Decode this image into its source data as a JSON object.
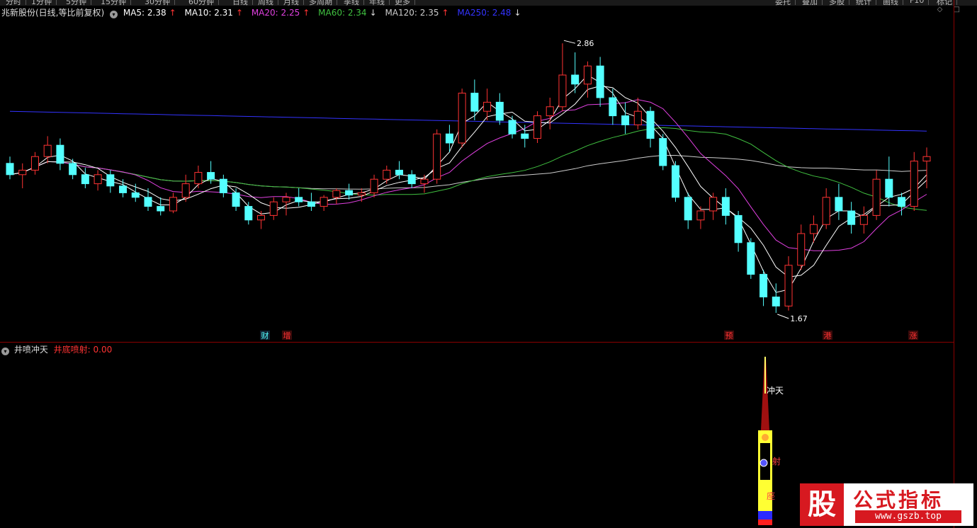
{
  "app": {
    "top_tabs": [
      "分时",
      "1分钟",
      "5分钟",
      "15分钟",
      "30分钟",
      "60分钟",
      "日线",
      "周线",
      "月线",
      "多周期",
      "季线",
      "年线",
      "更多"
    ],
    "right_tabs": [
      "委托",
      "叠加",
      "多股",
      "统计",
      "画线",
      "F10",
      "标记"
    ]
  },
  "main_legend": {
    "stock_title": "兆新股份(日线,等比前复权)",
    "ma5": "MA5: 2.38",
    "ma5_arrow": "↑",
    "ma10": "MA10: 2.31",
    "ma10_arrow": "↑",
    "ma20": "MA20: 2.25",
    "ma20_arrow": "↑",
    "ma60": "MA60: 2.34",
    "ma60_arrow": "↓",
    "ma120": "MA120: 2.35",
    "ma120_arrow": "↑",
    "ma250": "MA250: 2.48",
    "ma250_arrow": "↓"
  },
  "colors": {
    "up": "#ff3333",
    "down": "#54ffff",
    "ma5": "#ffffff",
    "ma10": "#ffffff",
    "ma20": "#e040e0",
    "ma60": "#40c040",
    "ma120": "#cccccc",
    "ma250": "#3333ff"
  },
  "annotations": {
    "high_label": "2.86",
    "low_label": "1.67",
    "event_markers": [
      "财",
      "增",
      "预",
      "港",
      "涨"
    ]
  },
  "sub_legend": {
    "indicator_name": "井喷冲天",
    "indicator_value": "井底喷射: 0.00"
  },
  "sub_annotations": {
    "label_top": "冲天",
    "label_mid": "射",
    "label_bottom": "座"
  },
  "watermark": {
    "logo_char": "股",
    "title": "公式指标",
    "url": "www.gszb.top"
  },
  "chart_data": {
    "type": "candlestick",
    "price_extremes": {
      "high": 2.86,
      "low": 1.67
    },
    "ohlc": [
      [
        2.33,
        2.36,
        2.26,
        2.28
      ],
      [
        2.28,
        2.33,
        2.22,
        2.3
      ],
      [
        2.3,
        2.38,
        2.28,
        2.36
      ],
      [
        2.36,
        2.45,
        2.33,
        2.41
      ],
      [
        2.41,
        2.44,
        2.3,
        2.33
      ],
      [
        2.33,
        2.35,
        2.26,
        2.28
      ],
      [
        2.28,
        2.31,
        2.22,
        2.24
      ],
      [
        2.24,
        2.3,
        2.21,
        2.28
      ],
      [
        2.28,
        2.3,
        2.2,
        2.23
      ],
      [
        2.23,
        2.26,
        2.18,
        2.2
      ],
      [
        2.2,
        2.24,
        2.16,
        2.18
      ],
      [
        2.18,
        2.22,
        2.12,
        2.14
      ],
      [
        2.14,
        2.18,
        2.1,
        2.12
      ],
      [
        2.12,
        2.2,
        2.11,
        2.18
      ],
      [
        2.18,
        2.28,
        2.16,
        2.24
      ],
      [
        2.24,
        2.32,
        2.22,
        2.29
      ],
      [
        2.29,
        2.34,
        2.24,
        2.26
      ],
      [
        2.26,
        2.28,
        2.18,
        2.2
      ],
      [
        2.2,
        2.22,
        2.12,
        2.14
      ],
      [
        2.14,
        2.16,
        2.06,
        2.08
      ],
      [
        2.08,
        2.12,
        2.04,
        2.1
      ],
      [
        2.1,
        2.18,
        2.08,
        2.16
      ],
      [
        2.16,
        2.2,
        2.1,
        2.18
      ],
      [
        2.18,
        2.22,
        2.14,
        2.16
      ],
      [
        2.16,
        2.2,
        2.12,
        2.14
      ],
      [
        2.14,
        2.19,
        2.12,
        2.18
      ],
      [
        2.18,
        2.22,
        2.15,
        2.21
      ],
      [
        2.21,
        2.24,
        2.17,
        2.19
      ],
      [
        2.19,
        2.22,
        2.16,
        2.2
      ],
      [
        2.2,
        2.28,
        2.18,
        2.26
      ],
      [
        2.26,
        2.32,
        2.24,
        2.3
      ],
      [
        2.3,
        2.34,
        2.26,
        2.28
      ],
      [
        2.28,
        2.3,
        2.22,
        2.24
      ],
      [
        2.24,
        2.28,
        2.2,
        2.26
      ],
      [
        2.26,
        2.48,
        2.24,
        2.46
      ],
      [
        2.46,
        2.5,
        2.38,
        2.42
      ],
      [
        2.42,
        2.66,
        2.4,
        2.64
      ],
      [
        2.64,
        2.7,
        2.52,
        2.56
      ],
      [
        2.56,
        2.66,
        2.52,
        2.6
      ],
      [
        2.6,
        2.64,
        2.5,
        2.52
      ],
      [
        2.52,
        2.54,
        2.44,
        2.46
      ],
      [
        2.46,
        2.5,
        2.4,
        2.44
      ],
      [
        2.44,
        2.56,
        2.42,
        2.54
      ],
      [
        2.54,
        2.62,
        2.48,
        2.58
      ],
      [
        2.58,
        2.86,
        2.56,
        2.72
      ],
      [
        2.72,
        2.82,
        2.64,
        2.68
      ],
      [
        2.68,
        2.78,
        2.62,
        2.76
      ],
      [
        2.76,
        2.8,
        2.58,
        2.62
      ],
      [
        2.62,
        2.66,
        2.5,
        2.54
      ],
      [
        2.54,
        2.6,
        2.46,
        2.5
      ],
      [
        2.5,
        2.62,
        2.48,
        2.56
      ],
      [
        2.56,
        2.58,
        2.4,
        2.44
      ],
      [
        2.44,
        2.46,
        2.3,
        2.32
      ],
      [
        2.32,
        2.34,
        2.16,
        2.18
      ],
      [
        2.18,
        2.2,
        2.04,
        2.08
      ],
      [
        2.08,
        2.14,
        2.04,
        2.12
      ],
      [
        2.12,
        2.2,
        2.08,
        2.18
      ],
      [
        2.18,
        2.22,
        2.06,
        2.1
      ],
      [
        2.1,
        2.12,
        1.94,
        1.98
      ],
      [
        1.98,
        2.0,
        1.82,
        1.84
      ],
      [
        1.84,
        1.86,
        1.7,
        1.74
      ],
      [
        1.74,
        1.8,
        1.67,
        1.7
      ],
      [
        1.7,
        1.92,
        1.68,
        1.88
      ],
      [
        1.88,
        2.06,
        1.86,
        2.02
      ],
      [
        2.02,
        2.1,
        1.98,
        2.06
      ],
      [
        2.06,
        2.22,
        2.04,
        2.18
      ],
      [
        2.18,
        2.24,
        2.08,
        2.12
      ],
      [
        2.12,
        2.16,
        2.02,
        2.06
      ],
      [
        2.06,
        2.14,
        2.02,
        2.1
      ],
      [
        2.1,
        2.3,
        2.08,
        2.26
      ],
      [
        2.26,
        2.36,
        2.14,
        2.18
      ],
      [
        2.18,
        2.2,
        2.1,
        2.14
      ],
      [
        2.14,
        2.38,
        2.12,
        2.34
      ],
      [
        2.34,
        2.4,
        2.22,
        2.36
      ]
    ],
    "ma_lines": [
      "MA5",
      "MA10",
      "MA20",
      "MA60",
      "MA120",
      "MA250"
    ]
  }
}
